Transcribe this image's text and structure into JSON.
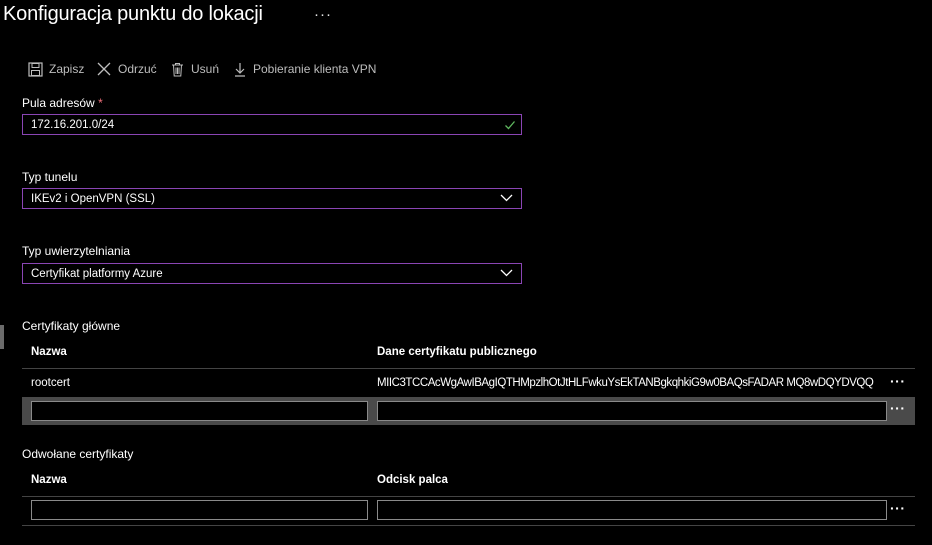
{
  "title": "Konfiguracja punktu do lokacji",
  "title_more": "···",
  "toolbar": {
    "save": "Zapisz",
    "discard": "Odrzuć",
    "delete": "Usuń",
    "download": "Pobieranie klienta VPN"
  },
  "address_pool": {
    "label": "Pula adresów",
    "required": "*",
    "value": "172.16.201.0/24"
  },
  "tunnel_type": {
    "label": "Typ tunelu",
    "value": "IKEv2 i OpenVPN (SSL)"
  },
  "auth_type": {
    "label": "Typ uwierzytelniania",
    "value": "Certyfikat platformy Azure"
  },
  "root_certs": {
    "label": "Certyfikaty główne",
    "col_name": "Nazwa",
    "col_data": "Dane certyfikatu publicznego",
    "rows": [
      {
        "name": "rootcert",
        "data": "MIIC3TCCAcWgAwIBAgIQTHMpzlhOtJtHLFwkuYsEkTANBgkqhkiG9w0BAQsFADAR MQ8wDQYDVQQ",
        "more": "···"
      }
    ],
    "new_row_more": "···"
  },
  "revoked_certs": {
    "label": "Odwołane certyfikaty",
    "col_name": "Nazwa",
    "col_thumb": "Odcisk palca",
    "new_row_more": "···"
  },
  "colors": {
    "accent_border": "#8a45b4",
    "valid_check": "#5fb75f",
    "required": "#f1707b"
  }
}
